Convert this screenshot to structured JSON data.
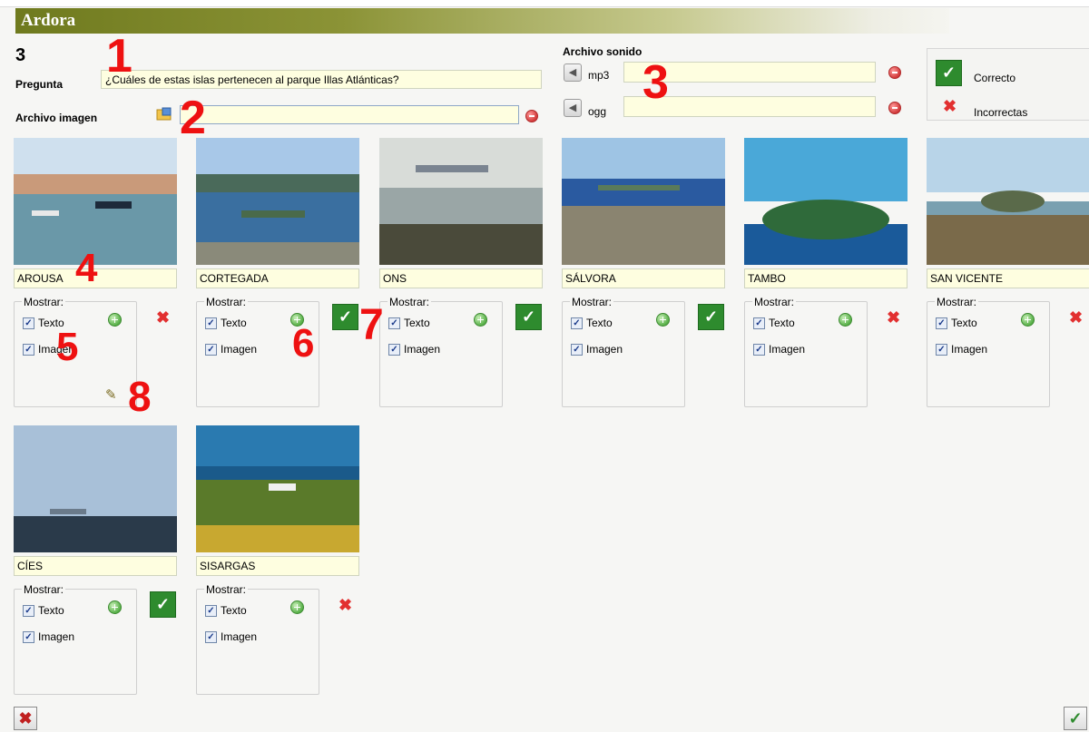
{
  "app": {
    "title": "Ardora"
  },
  "question": {
    "number": "3",
    "label": "Pregunta",
    "text": "¿Cuáles de estas islas pertenecen al parque Illas Atlánticas?"
  },
  "image_file": {
    "label": "Archivo imagen",
    "value": ""
  },
  "sound": {
    "label": "Archivo sonido",
    "mp3_label": "mp3",
    "mp3_value": "",
    "ogg_label": "ogg",
    "ogg_value": ""
  },
  "legend": {
    "correct_label": "Correcto",
    "incorrect_label": "Incorrectas"
  },
  "annotations": [
    "1",
    "2",
    "3",
    "4",
    "5",
    "6",
    "7",
    "8"
  ],
  "cards": [
    {
      "name": "AROUSA",
      "show_label": "Mostrar:",
      "text_label": "Texto",
      "image_label": "Imagen",
      "status": "incorrect",
      "scene": "harbor"
    },
    {
      "name": "CORTEGADA",
      "show_label": "Mostrar:",
      "text_label": "Texto",
      "image_label": "Imagen",
      "status": "correct",
      "scene": "bay"
    },
    {
      "name": "ONS",
      "show_label": "Mostrar:",
      "text_label": "Texto",
      "image_label": "Imagen",
      "status": "correct",
      "scene": "sea"
    },
    {
      "name": "SÁLVORA",
      "show_label": "Mostrar:",
      "text_label": "Texto",
      "image_label": "Imagen",
      "status": "correct",
      "scene": "coast"
    },
    {
      "name": "TAMBO",
      "show_label": "Mostrar:",
      "text_label": "Texto",
      "image_label": "Imagen",
      "status": "incorrect",
      "scene": "island"
    },
    {
      "name": "SAN VICENTE",
      "show_label": "Mostrar:",
      "text_label": "Texto",
      "image_label": "Imagen",
      "status": "incorrect",
      "scene": "hills"
    },
    {
      "name": "CÍES",
      "show_label": "Mostrar:",
      "text_label": "Texto",
      "image_label": "Imagen",
      "status": "correct",
      "scene": "dusk"
    },
    {
      "name": "SISARGAS",
      "show_label": "Mostrar:",
      "text_label": "Texto",
      "image_label": "Imagen",
      "status": "incorrect",
      "scene": "cliff"
    }
  ],
  "colors": {
    "accent_title": "#6f7a1e",
    "field_bg": "#fefee0",
    "correct": "#2e8b2e",
    "incorrect": "#e23030",
    "annotation": "#e11111"
  }
}
